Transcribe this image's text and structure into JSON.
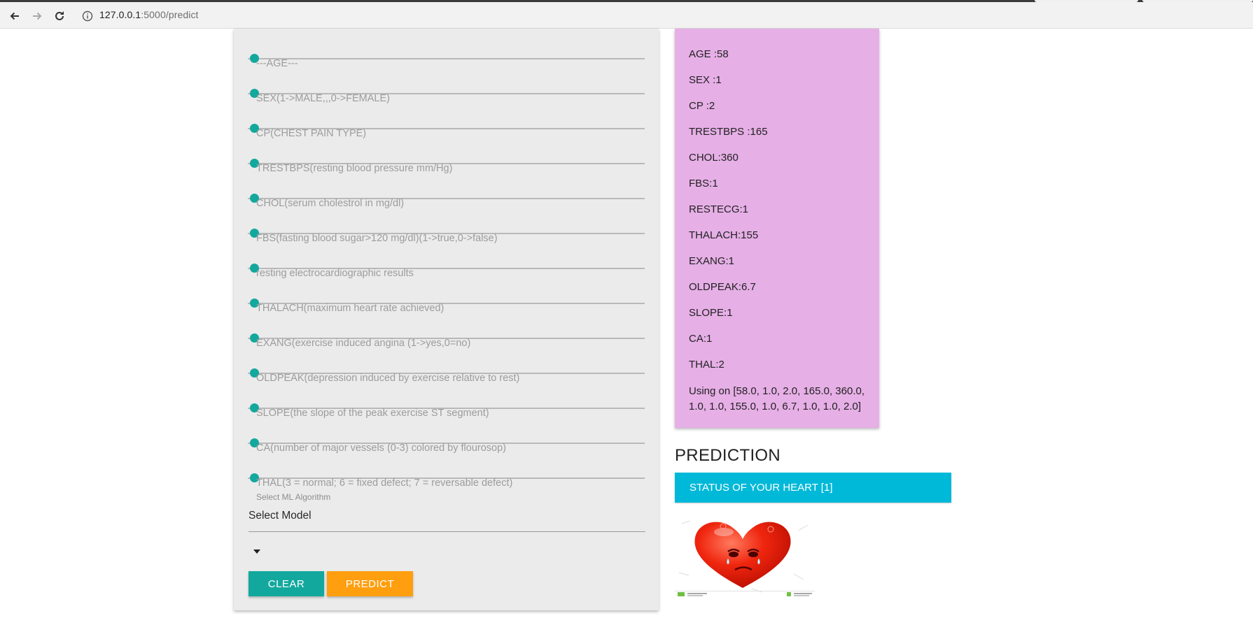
{
  "browser": {
    "url_host": "127.0.0.1",
    "url_rest": ":5000/predict"
  },
  "form": {
    "fields": [
      "---AGE---",
      "SEX(1->MALE,,,0->FEMALE)",
      "CP(CHEST PAIN TYPE)",
      "TRESTBPS(resting blood pressure mm/Hg)",
      "CHOL(serum cholestrol in mg/dl)",
      "FBS(fasting blood sugar>120 mg/dl)(1->true,0->false)",
      "resting electrocardiographic results",
      "THALACH(maximum heart rate achieved)",
      "EXANG(exercise induced angina (1->yes,0=no)",
      "OLDPEAK(depression induced by exercise relative to rest)",
      "SLOPE(the slope of the peak exercise ST segment)",
      "CA(number of major vessels (0-3) colored by flourosop)",
      "THAL(3 = normal; 6 = fixed defect; 7 = reversable defect)"
    ],
    "algorithm_label": "Select ML Algorithm",
    "select_title": "Select Model",
    "clear_label": "CLEAR",
    "predict_label": "PREDICT"
  },
  "values": {
    "rows": [
      "AGE :58",
      "SEX :1",
      "CP :2",
      "TRESTBPS :165",
      "CHOL:360",
      "FBS:1",
      "RESTECG:1",
      "THALACH:155",
      "EXANG:1",
      "OLDPEAK:6.7",
      "SLOPE:1",
      "CA:1",
      "THAL:2"
    ],
    "using": "Using on [58.0, 1.0, 2.0, 165.0, 360.0, 1.0, 1.0, 155.0, 1.0, 6.7, 1.0, 1.0, 2.0]"
  },
  "prediction": {
    "title": "PREDICTION",
    "status": "STATUS OF YOUR HEART [1]"
  },
  "colors": {
    "teal": "#13a89e",
    "orange": "#ff9e0f",
    "panel_pink": "#e6afe6",
    "status_cyan": "#00b9d9"
  },
  "icons": [
    "back-arrow-icon",
    "forward-arrow-icon",
    "reload-icon",
    "info-icon",
    "caret-down-icon",
    "sad-heart-image"
  ]
}
